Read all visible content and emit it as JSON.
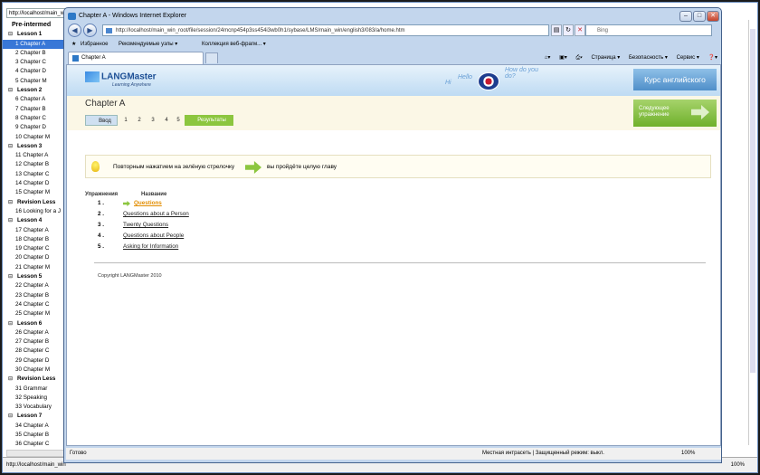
{
  "back_window": {
    "address": "http://localhost/main_win",
    "status": "http://localhost/main_win",
    "zoom": "100%",
    "tree": [
      {
        "label": "Pre-intermed",
        "level": 0
      },
      {
        "label": "Lesson 1",
        "level": 1
      },
      {
        "label": "1 Chapter A",
        "level": 2,
        "selected": true
      },
      {
        "label": "2 Chapter B",
        "level": 2
      },
      {
        "label": "3 Chapter C",
        "level": 2
      },
      {
        "label": "4 Chapter D",
        "level": 2
      },
      {
        "label": "5 Chapter M",
        "level": 2
      },
      {
        "label": "Lesson 2",
        "level": 1
      },
      {
        "label": "6 Chapter A",
        "level": 2
      },
      {
        "label": "7 Chapter B",
        "level": 2
      },
      {
        "label": "8 Chapter C",
        "level": 2
      },
      {
        "label": "9 Chapter D",
        "level": 2
      },
      {
        "label": "10 Chapter M",
        "level": 2
      },
      {
        "label": "Lesson 3",
        "level": 1
      },
      {
        "label": "11 Chapter A",
        "level": 2
      },
      {
        "label": "12 Chapter B",
        "level": 2
      },
      {
        "label": "13 Chapter C",
        "level": 2
      },
      {
        "label": "14 Chapter D",
        "level": 2
      },
      {
        "label": "15 Chapter M",
        "level": 2
      },
      {
        "label": "Revision Less",
        "level": 1
      },
      {
        "label": "16 Looking for a J",
        "level": 2
      },
      {
        "label": "Lesson 4",
        "level": 1
      },
      {
        "label": "17 Chapter A",
        "level": 2
      },
      {
        "label": "18 Chapter B",
        "level": 2
      },
      {
        "label": "19 Chapter C",
        "level": 2
      },
      {
        "label": "20 Chapter D",
        "level": 2
      },
      {
        "label": "21 Chapter M",
        "level": 2
      },
      {
        "label": "Lesson 5",
        "level": 1
      },
      {
        "label": "22 Chapter A",
        "level": 2
      },
      {
        "label": "23 Chapter B",
        "level": 2
      },
      {
        "label": "24 Chapter C",
        "level": 2
      },
      {
        "label": "25 Chapter M",
        "level": 2
      },
      {
        "label": "Lesson 6",
        "level": 1
      },
      {
        "label": "26 Chapter A",
        "level": 2
      },
      {
        "label": "27 Chapter B",
        "level": 2
      },
      {
        "label": "28 Chapter C",
        "level": 2
      },
      {
        "label": "29 Chapter D",
        "level": 2
      },
      {
        "label": "30 Chapter M",
        "level": 2
      },
      {
        "label": "Revision Less",
        "level": 1
      },
      {
        "label": "31 Grammar",
        "level": 2
      },
      {
        "label": "32 Speaking",
        "level": 2
      },
      {
        "label": "33 Vocabulary",
        "level": 2
      },
      {
        "label": "Lesson 7",
        "level": 1
      },
      {
        "label": "34 Chapter A",
        "level": 2
      },
      {
        "label": "35 Chapter B",
        "level": 2
      },
      {
        "label": "36 Chapter C",
        "level": 2
      }
    ]
  },
  "ie": {
    "title": "Chapter A - Windows Internet Explorer",
    "address": "http://localhost/main_win_root/file/session/24mcnp454p3ss454i3wb0h1/sybase/LMS/main_win/english3/083/a/home.htm",
    "search_placeholder": "Bing",
    "favorites": "Избранное",
    "fav_links": [
      "Рекомендуемые узлы ▾",
      "Коллекция веб-фрагм... ▾"
    ],
    "tab_label": "Chapter A",
    "tools": [
      "Страница ▾",
      "Безопасность ▾",
      "Сервис ▾",
      "❓▾"
    ],
    "status_left": "Готово",
    "status_zone": "Местная интрасеть | Защищенный режим: выкл.",
    "zoom": "100%"
  },
  "page": {
    "logo": "LANGMaster",
    "tagline": "Learning Anywhere",
    "bubbles": [
      "Hi",
      "Hello",
      "How do you do?"
    ],
    "course": "Курс английского",
    "chapter_title": "Chapter A",
    "tabs": [
      "Ввод",
      "1",
      "2",
      "3",
      "4",
      "5"
    ],
    "results": "Результаты",
    "next": [
      "Следующее",
      "упражнение"
    ],
    "hint_before": "Повторным нажатием на зелёную стрелочку",
    "hint_after": "вы пройдёте целую главу",
    "col_exercises": "Упражнения",
    "col_name": "Название",
    "exercises": [
      {
        "num": "1 .",
        "title": "Questions",
        "current": true
      },
      {
        "num": "2 .",
        "title": "Questions about a Person"
      },
      {
        "num": "3 .",
        "title": "Twenty Questions"
      },
      {
        "num": "4 .",
        "title": "Questions about People"
      },
      {
        "num": "5 .",
        "title": "Asking for Information"
      }
    ],
    "copyright": "Copyright LANGMaster 2010"
  }
}
